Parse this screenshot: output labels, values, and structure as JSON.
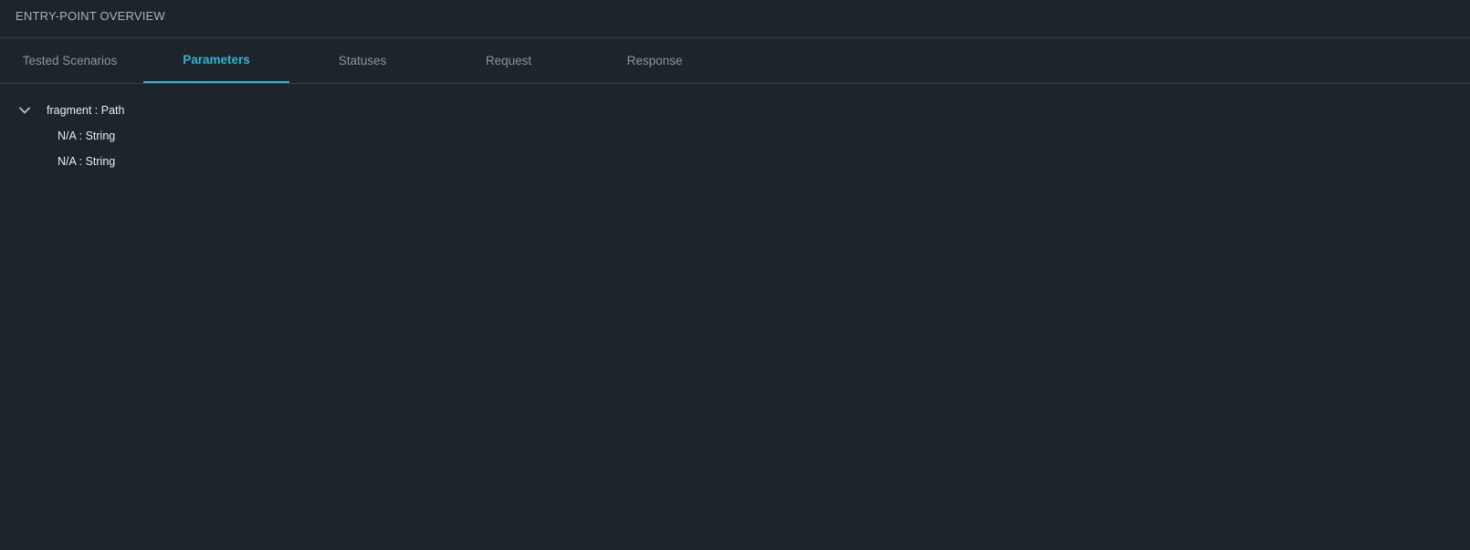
{
  "panel": {
    "title": "ENTRY-POINT OVERVIEW"
  },
  "tabs": [
    {
      "label": "Tested Scenarios",
      "active": false
    },
    {
      "label": "Parameters",
      "active": true
    },
    {
      "label": "Statuses",
      "active": false
    },
    {
      "label": "Request",
      "active": false
    },
    {
      "label": "Response",
      "active": false
    }
  ],
  "tree": {
    "root": {
      "label": "fragment : Path",
      "expanded": true,
      "icon": "chevron-down-icon",
      "children": [
        {
          "label": "N/A : String"
        },
        {
          "label": "N/A : String"
        }
      ]
    }
  },
  "colors": {
    "background": "#1e252a",
    "accent": "#2fb3d2",
    "border": "#37434b",
    "tab_inactive": "#8a959c",
    "text": "#e6ebee"
  }
}
